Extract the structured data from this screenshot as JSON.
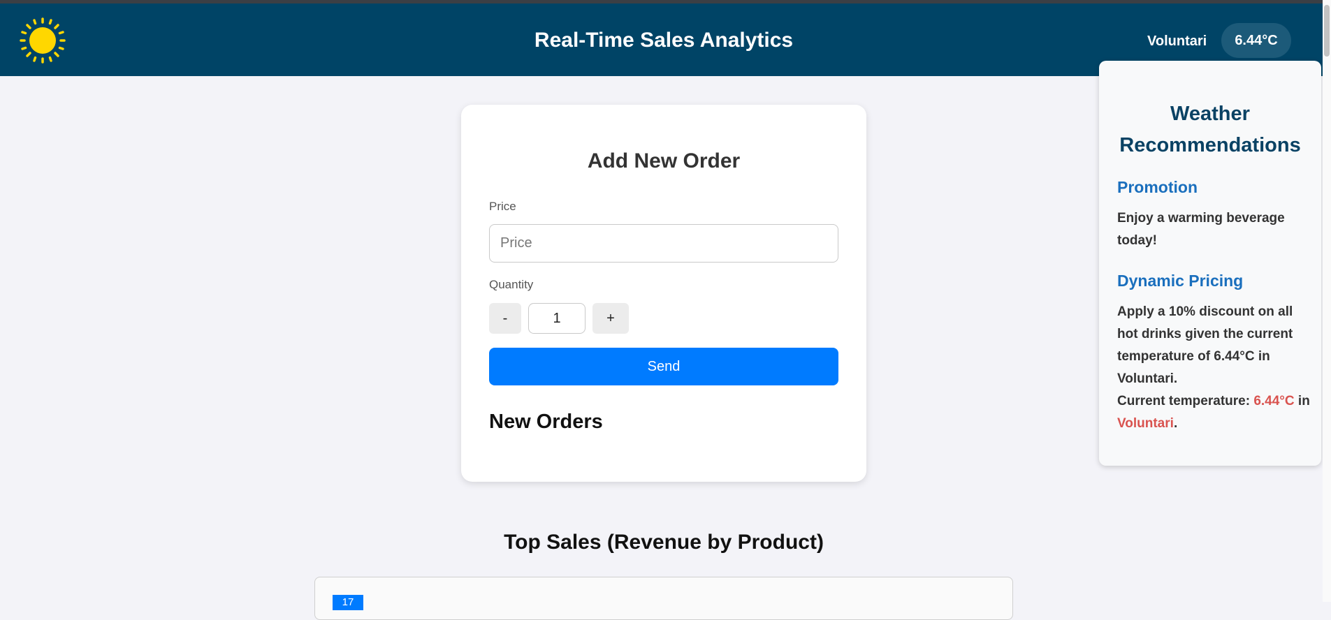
{
  "header": {
    "title": "Real-Time Sales Analytics",
    "city": "Voluntari",
    "temperature": "6.44°C",
    "logo_icon": "sun-icon"
  },
  "order_form": {
    "title": "Add New Order",
    "price_label": "Price",
    "price_placeholder": "Price",
    "price_value": "",
    "quantity_label": "Quantity",
    "decrement_label": "-",
    "quantity_value": "1",
    "increment_label": "+",
    "send_label": "Send",
    "new_orders_heading": "New Orders"
  },
  "weather_panel": {
    "title": "Weather Recommendations",
    "promotion_heading": "Promotion",
    "promotion_text": "Enjoy a warming beverage today!",
    "pricing_heading": "Dynamic Pricing",
    "pricing_text": "Apply a 10% discount on all hot drinks given the current temperature of 6.44°C in Voluntari.",
    "current_prefix": "Current temperature:",
    "current_temp": "6.44°C",
    "current_in": "in",
    "current_city": "Voluntari",
    "current_suffix": "."
  },
  "top_sales": {
    "title": "Top Sales (Revenue by Product)",
    "chart_tag": "17"
  },
  "colors": {
    "header_bg": "#004466",
    "accent_blue": "#007bff",
    "highlight_red": "#d9534f",
    "sun_yellow": "#ffd700"
  }
}
